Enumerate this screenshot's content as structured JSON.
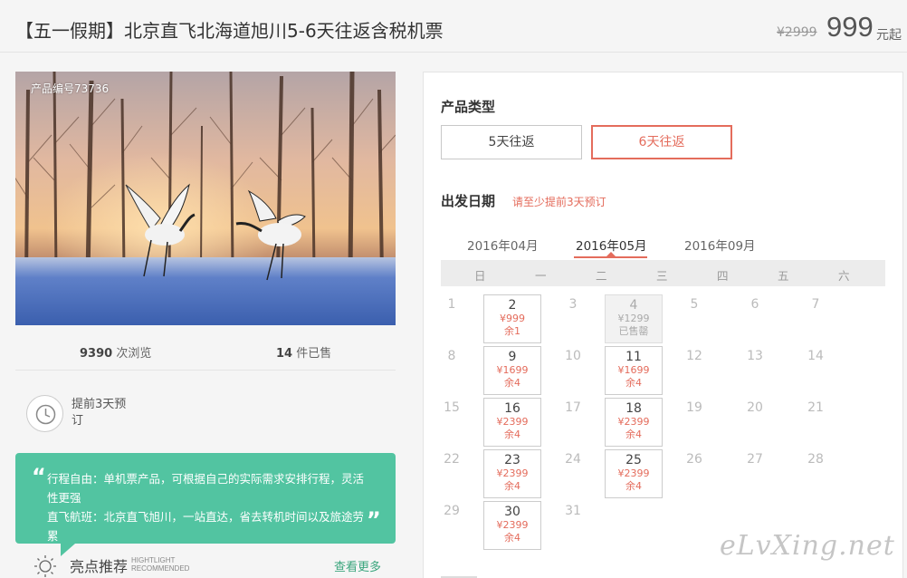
{
  "header": {
    "title": "【五一假期】北京直飞北海道旭川5-6天往返含税机票",
    "price_old": "¥2999",
    "price_now": "999",
    "price_unit": "元起"
  },
  "photo": {
    "product_code": "产品编号73736",
    "icon": "red-crowned-cranes-photo"
  },
  "stats": {
    "views_count": "9390",
    "views_label": "次浏览",
    "sold_count": "14",
    "sold_label": "件已售"
  },
  "advance": {
    "text": "提前3天预订",
    "icon": "clock-icon"
  },
  "quote": {
    "line1": "行程自由：单机票产品，可根据自己的实际需求安排行程，灵活性更强",
    "line2": "直飞航班：北京直飞旭川，一站直达，省去转机时间以及旅途劳累"
  },
  "highlight": {
    "title": "亮点推荐",
    "sub1": "HIGHTLIGHT",
    "sub2": "RECOMMENDED",
    "more": "查看更多"
  },
  "panel": {
    "type_label": "产品类型",
    "options": [
      "5天往返",
      "6天往返"
    ],
    "selected_option": "6天往返",
    "date_label": "出发日期",
    "date_hint": "请至少提前3天预订",
    "months": [
      "2016年04月",
      "2016年05月",
      "2016年09月"
    ],
    "selected_month": "2016年05月",
    "weekdays": [
      "日",
      "一",
      "二",
      "三",
      "四",
      "五",
      "六"
    ],
    "days": [
      {
        "d": "1"
      },
      {
        "d": "2",
        "price": "¥999",
        "stock": "余1"
      },
      {
        "d": "3"
      },
      {
        "d": "4",
        "price": "¥1299",
        "stock": "已售罄",
        "sold_out": true
      },
      {
        "d": "5"
      },
      {
        "d": "6"
      },
      {
        "d": "7"
      },
      {
        "d": "8"
      },
      {
        "d": "9",
        "price": "¥1699",
        "stock": "余4"
      },
      {
        "d": "10"
      },
      {
        "d": "11",
        "price": "¥1699",
        "stock": "余4"
      },
      {
        "d": "12"
      },
      {
        "d": "13"
      },
      {
        "d": "14"
      },
      {
        "d": "15"
      },
      {
        "d": "16",
        "price": "¥2399",
        "stock": "余4"
      },
      {
        "d": "17"
      },
      {
        "d": "18",
        "price": "¥2399",
        "stock": "余4"
      },
      {
        "d": "19"
      },
      {
        "d": "20"
      },
      {
        "d": "21"
      },
      {
        "d": "22"
      },
      {
        "d": "23",
        "price": "¥2399",
        "stock": "余4"
      },
      {
        "d": "24"
      },
      {
        "d": "25",
        "price": "¥2399",
        "stock": "余4"
      },
      {
        "d": "26"
      },
      {
        "d": "27"
      },
      {
        "d": "28"
      },
      {
        "d": "29"
      },
      {
        "d": "30",
        "price": "¥2399",
        "stock": "余4"
      },
      {
        "d": "31"
      }
    ]
  },
  "watermark": "eLvXing.net",
  "colors": {
    "accent": "#e46c5c",
    "green": "#52c4a1"
  }
}
